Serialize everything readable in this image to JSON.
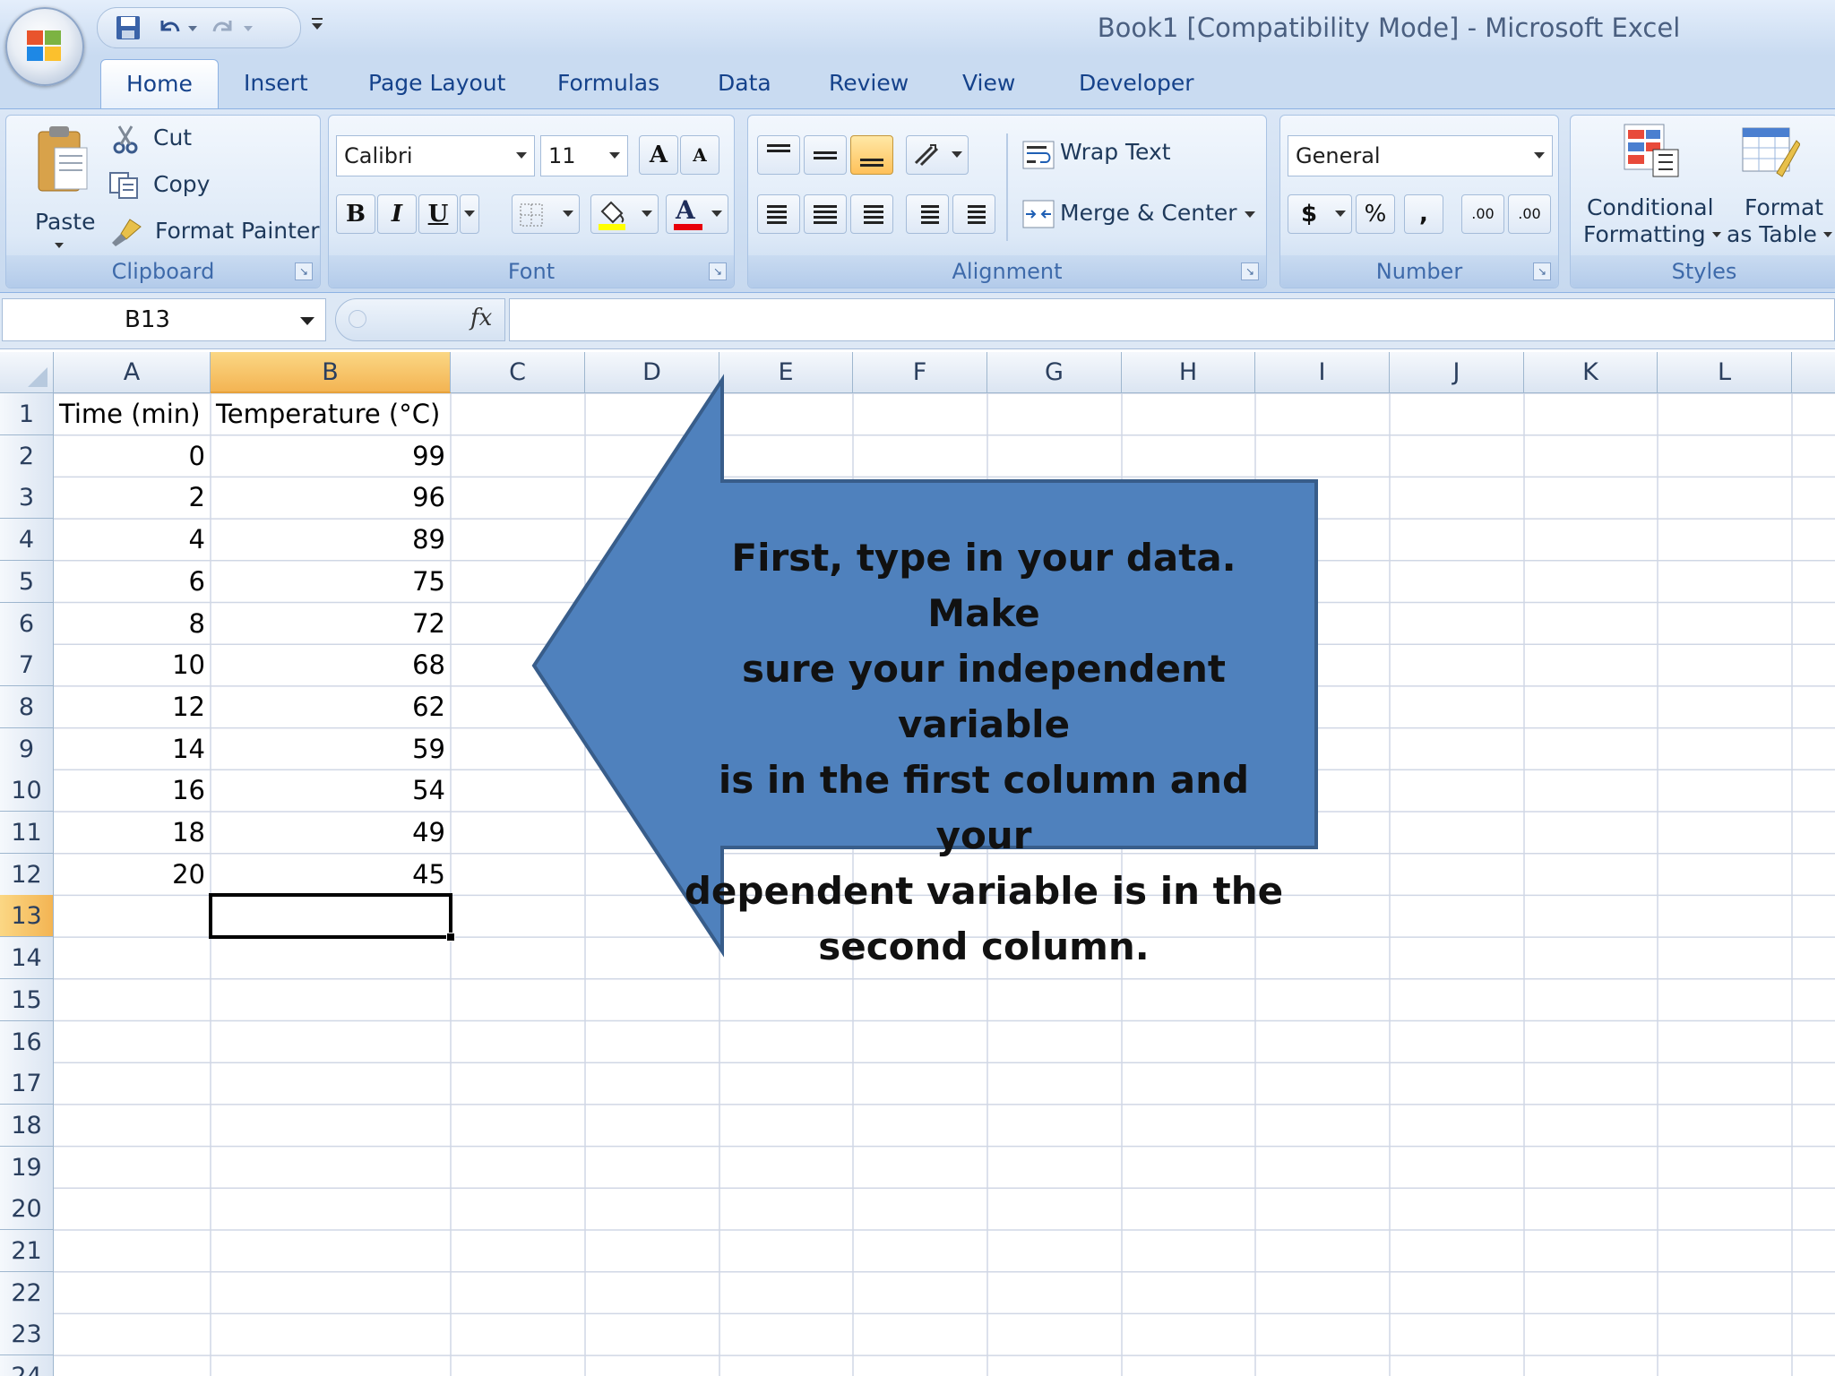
{
  "window": {
    "title": "Book1  [Compatibility Mode]  -  Microsoft Excel"
  },
  "tabs": [
    "Home",
    "Insert",
    "Page Layout",
    "Formulas",
    "Data",
    "Review",
    "View",
    "Developer"
  ],
  "active_tab": "Home",
  "ribbon": {
    "clipboard": {
      "paste": "Paste",
      "cut": "Cut",
      "copy": "Copy",
      "format_painter": "Format Painter",
      "label": "Clipboard"
    },
    "font": {
      "family": "Calibri",
      "size": "11",
      "bold": "B",
      "italic": "I",
      "underline": "U",
      "grow": "A",
      "shrink": "A",
      "font_color_glyph": "A",
      "label": "Font",
      "fill_color": "#ffff00",
      "font_color": "#e8000b"
    },
    "alignment": {
      "wrap_text": "Wrap Text",
      "merge_center": "Merge & Center",
      "label": "Alignment"
    },
    "number": {
      "format": "General",
      "currency": "$",
      "percent": "%",
      "comma": ",",
      "increase_decimal": ".00",
      "decrease_decimal": ".00",
      "label": "Number"
    },
    "styles": {
      "conditional_formatting": "Conditional",
      "conditional_formatting_2": "Formatting",
      "format_as_table": "Format",
      "format_as_table_2": "as Table",
      "label": "Styles"
    }
  },
  "formula_bar": {
    "name_box": "B13",
    "fx": "fx",
    "formula": ""
  },
  "columns": [
    "A",
    "B",
    "C",
    "D",
    "E",
    "F",
    "G",
    "H",
    "I",
    "J",
    "K",
    "L"
  ],
  "selected_column": "B",
  "selected_row": "13",
  "rows": [
    "1",
    "2",
    "3",
    "4",
    "5",
    "6",
    "7",
    "8",
    "9",
    "10",
    "11",
    "12",
    "13",
    "14",
    "15",
    "16",
    "17",
    "18",
    "19",
    "20",
    "21",
    "22",
    "23",
    "24"
  ],
  "sheet": {
    "headers": [
      "Time (min)",
      "Temperature (°C)"
    ],
    "data": [
      [
        "0",
        "99"
      ],
      [
        "2",
        "96"
      ],
      [
        "4",
        "89"
      ],
      [
        "6",
        "75"
      ],
      [
        "8",
        "72"
      ],
      [
        "10",
        "68"
      ],
      [
        "12",
        "62"
      ],
      [
        "14",
        "59"
      ],
      [
        "16",
        "54"
      ],
      [
        "18",
        "49"
      ],
      [
        "20",
        "45"
      ]
    ]
  },
  "callout": {
    "lines": [
      "First, type in your data. Make",
      "sure your independent variable",
      "is in the first column and your",
      "dependent variable is in the",
      "second column."
    ],
    "fill": "#4f81bd",
    "border": "#385d8a"
  }
}
